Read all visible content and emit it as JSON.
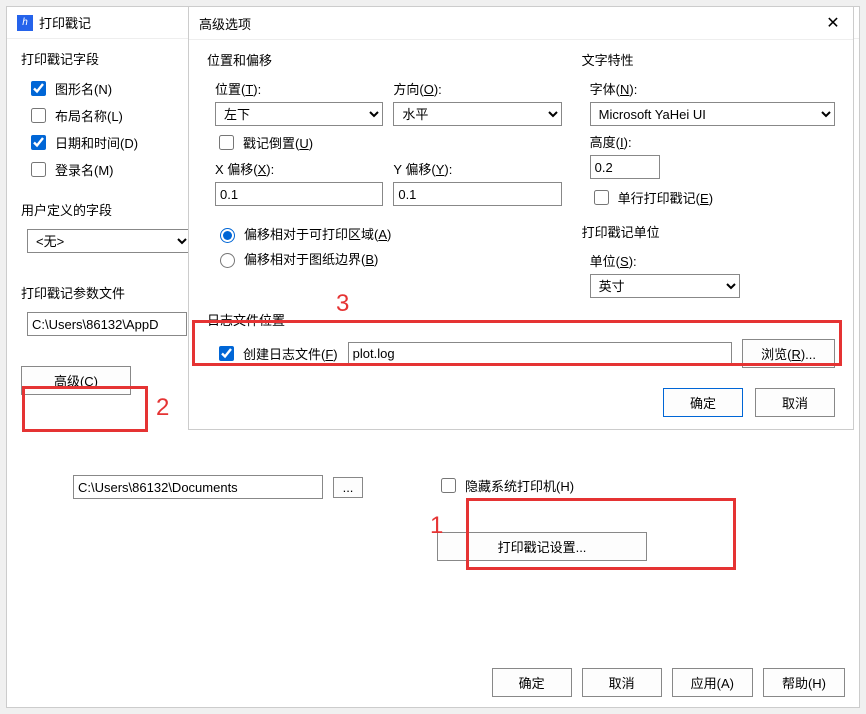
{
  "back": {
    "title": "打印戳记",
    "fields_legend": "打印戳记字段",
    "cb_drawing": "图形名(N)",
    "cb_layout": "布局名称(L)",
    "cb_datetime": "日期和时间(D)",
    "cb_login": "登录名(M)",
    "user_legend": "用户定义的字段",
    "user_value": "<无>",
    "paramfile_legend": "打印戳记参数文件",
    "paramfile_value": "C:\\Users\\86132\\AppD",
    "advanced_btn": "高级(C)",
    "docpath": "C:\\Users\\86132\\Documents",
    "browse_dots": "...",
    "cb_hideprinter": "隐藏系统打印机(H)",
    "stamp_settings_btn": "打印戳记设置...",
    "ok": "确定",
    "cancel": "取消",
    "apply": "应用(A)",
    "help": "帮助(H)"
  },
  "adv": {
    "title": "高级选项",
    "pos_legend": "位置和偏移",
    "pos_label": "位置(T):",
    "pos_value": "左下",
    "dir_label": "方向(O):",
    "dir_value": "水平",
    "cb_invert": "戳记倒置(U)",
    "xoff_label": "X 偏移(X):",
    "xoff_value": "0.1",
    "yoff_label": "Y 偏移(Y):",
    "yoff_value": "0.1",
    "radio_printable": "偏移相对于可打印区域(A)",
    "radio_paper": "偏移相对于图纸边界(B)",
    "text_legend": "文字特性",
    "font_label": "字体(N):",
    "font_value": "Microsoft YaHei UI",
    "height_label": "高度(I):",
    "height_value": "0.2",
    "cb_singleline": "单行打印戳记(E)",
    "unit_legend": "打印戳记单位",
    "unit_label": "单位(S):",
    "unit_value": "英寸",
    "log_legend": "日志文件位置",
    "cb_createlog": "创建日志文件(F)",
    "log_value": "plot.log",
    "browse_btn": "浏览(R)...",
    "ok": "确定",
    "cancel": "取消"
  },
  "ann": {
    "n1": "1",
    "n2": "2",
    "n3": "3"
  }
}
